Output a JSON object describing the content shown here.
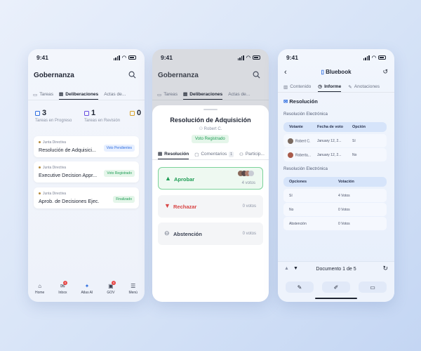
{
  "status_time": "9:41",
  "screen1": {
    "title": "Gobernanza",
    "tabs": [
      {
        "label": "Tareas"
      },
      {
        "label": "Deliberaciones"
      },
      {
        "label": "Actas de..."
      }
    ],
    "stats": [
      {
        "value": "3",
        "label": "Tareas en Progreso"
      },
      {
        "value": "1",
        "label": "Tareas en Revisión"
      },
      {
        "value": "0",
        "label": ""
      }
    ],
    "cards": [
      {
        "org": "Junta Directiva",
        "name": "Resolución de Adquisici...",
        "badge": "Voto Pendientes"
      },
      {
        "org": "Junta Directiva",
        "name": "Executive Decision Appr...",
        "badge": "Voto Registrado"
      },
      {
        "org": "Junta Directiva",
        "name": "Aprob. de Decisiones Ejec...",
        "badge": "Finalizado"
      }
    ],
    "nav": [
      {
        "label": "Home",
        "badge": ""
      },
      {
        "label": "Inbox",
        "badge": "4"
      },
      {
        "label": "Atlas AI",
        "badge": ""
      },
      {
        "label": "GOV",
        "badge": "4"
      },
      {
        "label": "Menú",
        "badge": ""
      }
    ]
  },
  "screen2": {
    "title": "Gobernanza",
    "tabs": [
      {
        "label": "Tareas"
      },
      {
        "label": "Deliberaciones"
      },
      {
        "label": "Actas de..."
      }
    ],
    "sheet": {
      "title": "Resolución de Adquisición",
      "user": "Robert C.",
      "badge": "Voto Registrado",
      "tabs": [
        {
          "label": "Resolución",
          "count": ""
        },
        {
          "label": "Comentarios",
          "count": "1"
        },
        {
          "label": "Particip...",
          "count": ""
        }
      ],
      "options": [
        {
          "label": "Aprobar",
          "votes": "4 votos"
        },
        {
          "label": "Rechazar",
          "votes": "0 votos"
        },
        {
          "label": "Abstención",
          "votes": "0 votos"
        }
      ]
    }
  },
  "screen3": {
    "title": "Bluebook",
    "tabs": [
      {
        "label": "Contenido"
      },
      {
        "label": "Informe"
      },
      {
        "label": "Anotaciones"
      }
    ],
    "section": "Resolución",
    "sub1": "Resolución Electrónica",
    "table1": {
      "headers": [
        "Votante",
        "Fecha de voto",
        "Opción"
      ],
      "rows": [
        [
          "Robert C.",
          "January 12, 2...",
          "Sí"
        ],
        [
          "Roberta...",
          "January 12, 2...",
          "No"
        ]
      ]
    },
    "sub2": "Resolución Electrónica",
    "table2": {
      "headers": [
        "Opciones",
        "Votación"
      ],
      "rows": [
        [
          "Sí",
          "4 Votos"
        ],
        [
          "No",
          "0 Votos"
        ],
        [
          "Abstención",
          "0 Votos"
        ]
      ]
    },
    "doc": "Documento 1 de 5"
  }
}
